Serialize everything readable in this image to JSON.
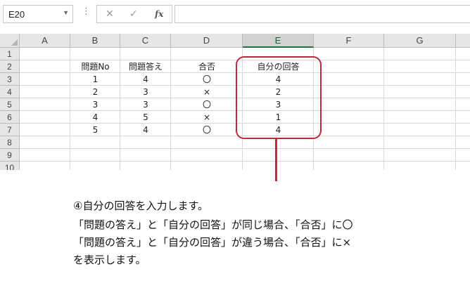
{
  "name_box": {
    "value": "E20"
  },
  "formula_bar": {
    "cancel": "✕",
    "enter": "✓",
    "fx": "fx",
    "value": ""
  },
  "columns": [
    "A",
    "B",
    "C",
    "D",
    "E",
    "F",
    "G"
  ],
  "selected_column": "E",
  "rows": [
    "1",
    "2",
    "3",
    "4",
    "5",
    "6",
    "7",
    "8",
    "9",
    "10"
  ],
  "table": {
    "headers": {
      "b": "問題No",
      "c": "問題答え",
      "d": "合否",
      "e": "自分の回答"
    },
    "rows": [
      {
        "b": "1",
        "c": "4",
        "d": "〇",
        "e": "4"
      },
      {
        "b": "2",
        "c": "3",
        "d": "×",
        "e": "2"
      },
      {
        "b": "3",
        "c": "3",
        "d": "〇",
        "e": "3"
      },
      {
        "b": "4",
        "c": "5",
        "d": "×",
        "e": "1"
      },
      {
        "b": "5",
        "c": "4",
        "d": "〇",
        "e": "4"
      }
    ]
  },
  "explanation": {
    "line1": "④自分の回答を入力します。",
    "line2": "「問題の答え」と「自分の回答」が同じ場合、「合否」に〇",
    "line3": "「問題の答え」と「自分の回答」が違う場合、「合否」に×",
    "line4": "を表示します。"
  },
  "colors": {
    "highlight": "#c0283c",
    "selected_header_accent": "#217346"
  }
}
